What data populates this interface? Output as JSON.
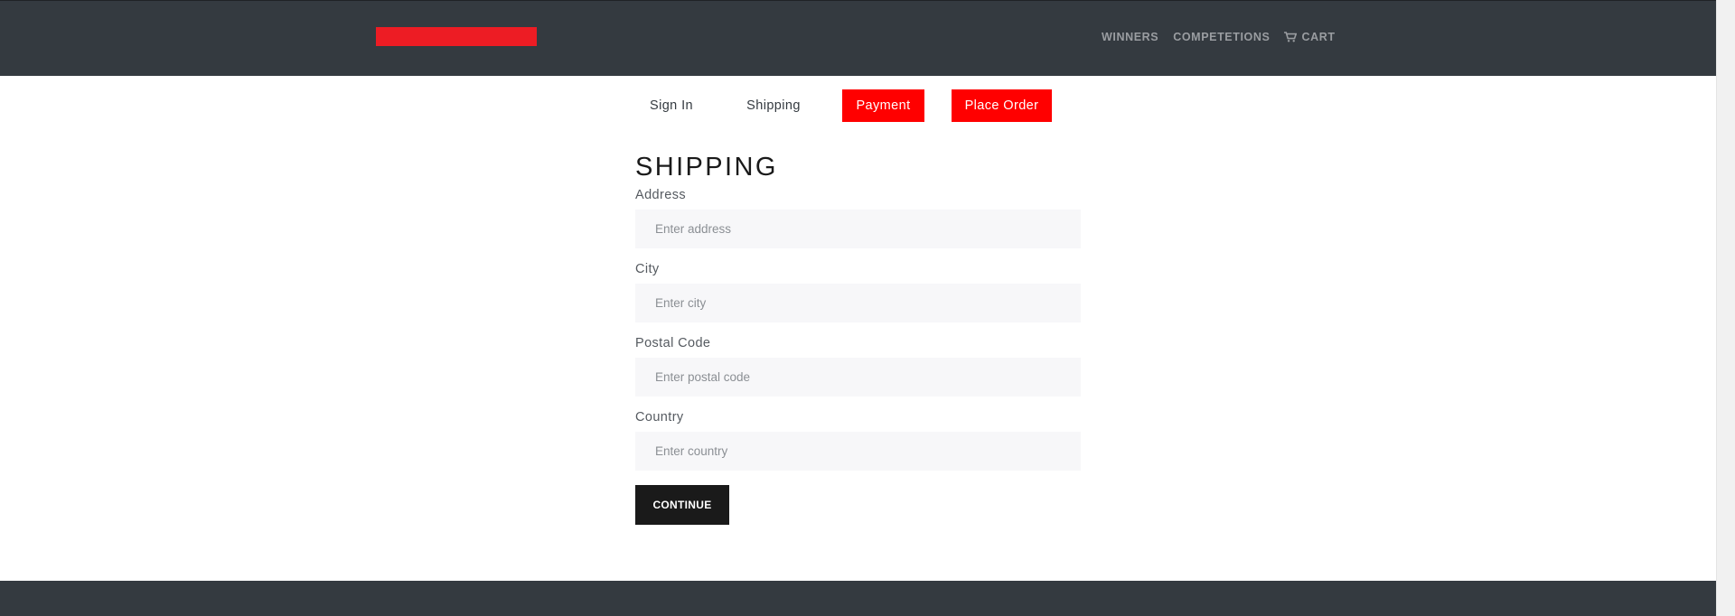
{
  "header": {
    "brand_color": "#ed1c24",
    "background_color": "#343a40",
    "nav": [
      {
        "label": "WINNERS"
      },
      {
        "label": "COMPETETIONS"
      },
      {
        "label": "CART",
        "icon": "cart-icon"
      }
    ]
  },
  "steps": [
    {
      "label": "Sign In",
      "state": "enabled"
    },
    {
      "label": "Shipping",
      "state": "enabled"
    },
    {
      "label": "Payment",
      "state": "disabled"
    },
    {
      "label": "Place Order",
      "state": "disabled"
    }
  ],
  "form": {
    "title": "SHIPPING",
    "fields": {
      "address": {
        "label": "Address",
        "placeholder": "Enter address",
        "value": ""
      },
      "city": {
        "label": "City",
        "placeholder": "Enter city",
        "value": ""
      },
      "postal_code": {
        "label": "Postal Code",
        "placeholder": "Enter postal code",
        "value": ""
      },
      "country": {
        "label": "Country",
        "placeholder": "Enter country",
        "value": ""
      }
    },
    "submit_label": "CONTINUE"
  },
  "colors": {
    "disabled_step": "#ff0000",
    "button": "#1a1a1a",
    "input_background": "#f7f7f9"
  }
}
